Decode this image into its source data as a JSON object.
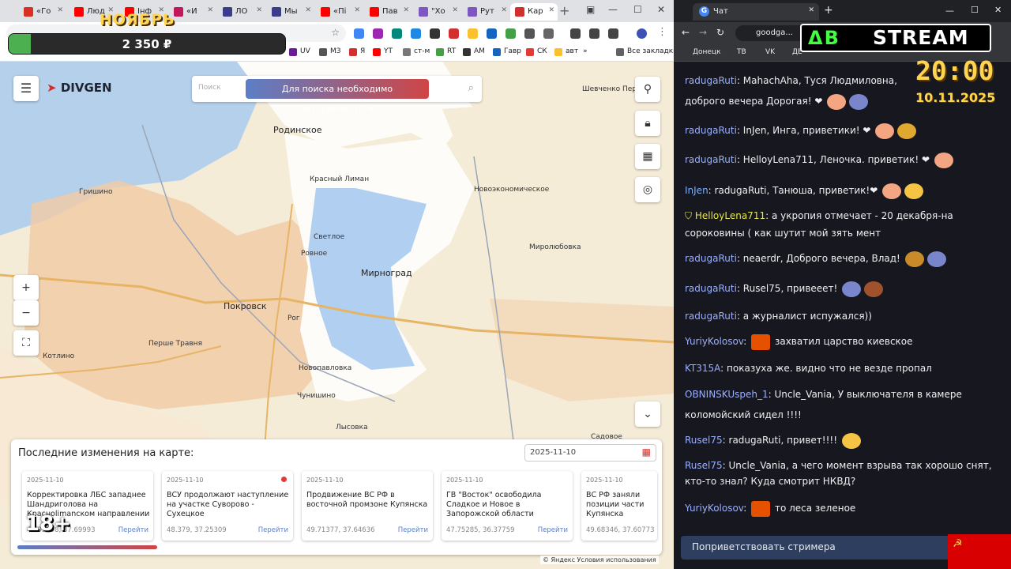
{
  "left_browser": {
    "tabs": [
      {
        "label": "«Го",
        "color": "#d93025"
      },
      {
        "label": "Люд",
        "color": "#ff0000"
      },
      {
        "label": "Інф",
        "color": "#ff0000"
      },
      {
        "label": "«И",
        "color": "#c2185b"
      },
      {
        "label": "ЛО",
        "color": "#3c3c8c"
      },
      {
        "label": "Мы",
        "color": "#3c3c8c"
      },
      {
        "label": "«Пі",
        "color": "#ff0000"
      },
      {
        "label": "Пав",
        "color": "#ff0000"
      },
      {
        "label": "\"Хо",
        "color": "#7e57c2"
      },
      {
        "label": "Рут",
        "color": "#7e57c2"
      },
      {
        "label": "Кар",
        "color": "#d32f2f",
        "active": true
      }
    ],
    "bookmarks": [
      "UV",
      "МЗ",
      "Я",
      "YT",
      "ст-м",
      "RT",
      "АМ",
      "Гавр",
      "СК",
      "авт",
      "»",
      "Все закладки"
    ]
  },
  "overlay": {
    "month": "НОЯБРЬ",
    "amount": "2 350 ₽",
    "progress": 0.08,
    "age": "18+"
  },
  "map_app": {
    "brand": "DIVGEN",
    "search_placeholder": "Поиск",
    "auth_prompt": "Для поиска необходимо авторизоваться",
    "zoom_in": "+",
    "zoom_out": "−",
    "labels": {
      "rodinskoe": "Родинское",
      "krasny_liman": "Красный Лиман",
      "grishino": "Гришино",
      "svetloe": "Светлое",
      "rovnoe": "Ровное",
      "mirnograd": "Мирноград",
      "pokrovsk": "Покровск",
      "rog": "Рог",
      "novopavlovka": "Новопавловка",
      "pershe_travnya": "Перше Травня",
      "kotlino": "Котлино",
      "chunishino": "Чунишино",
      "lysovka": "Лысовка",
      "novoekonomicheskoe": "Новоэкономическое",
      "mirolyubovka": "Миролюбовка",
      "shevchenko": "Шевченко Первое",
      "sadovoe": "Садовое"
    },
    "panel": {
      "title": "Последние изменения на карте:",
      "date": "2025-11-10",
      "open_label": "Перейти",
      "cards": [
        {
          "date": "2025-11-10",
          "title": "Корректировка ЛБС западнее Шандриголова на Красноlimanском направлении",
          "coords": "48.99998, 37.69993"
        },
        {
          "date": "2025-11-10",
          "title": "ВСУ продолжают наступление на участке Суворово - Сухецкое",
          "coords": "48.379, 37.25309",
          "dot": true
        },
        {
          "date": "2025-11-10",
          "title": "Продвижение ВС РФ в восточной промзоне Купянска",
          "coords": "49.71377, 37.64636"
        },
        {
          "date": "2025-11-10",
          "title": "ГВ \"Восток\" освободила Сладкое и Новое в Запорожской области",
          "coords": "47.75285, 36.37759"
        },
        {
          "date": "2025-11-10",
          "title": "ВС РФ заняли позиции части Купянска",
          "coords": "49.68346, 37.60773"
        }
      ]
    },
    "attribution": "© Яндекс Условия использования"
  },
  "right_browser": {
    "tab_label": "Чат",
    "url": "goodga...",
    "bookmarks": [
      "Донецк",
      "ТВ",
      "VK",
      "ДЕ"
    ]
  },
  "stream": {
    "logo_a": "ΔB",
    "logo_b": "STREAM",
    "time": "20:00",
    "date": "10.11.2025"
  },
  "chat": [
    {
      "user": "radugaRuti",
      "color": "#9ab0ff",
      "text": "MahachAha, Туся Людмиловна, доброго вечера Дорогая! ❤"
    },
    {
      "user": "radugaRuti",
      "color": "#9ab0ff",
      "text": "InJen, Инга, приветики! ❤"
    },
    {
      "user": "radugaRuti",
      "color": "#9ab0ff",
      "text": "HelloyLena711, Леночка. приветик! ❤"
    },
    {
      "user": "InJen",
      "color": "#7ab0ff",
      "text": "radugaRuti, Танюша, приветик!❤"
    },
    {
      "user": "HelloyLena711",
      "color": "#e6e64a",
      "text": "а укропия отмечает - 20 декабря-на сороковины ( как шутит мой зять мент"
    },
    {
      "user": "radugaRuti",
      "color": "#9ab0ff",
      "text": "neaerdr, Доброго вечера, Влад!"
    },
    {
      "user": "radugaRuti",
      "color": "#9ab0ff",
      "text": "Rusel75, привееет!"
    },
    {
      "user": "radugaRuti",
      "color": "#9ab0ff",
      "text": "а журналист испужался))"
    },
    {
      "user": "YuriyKolosov",
      "color": "#9ab0ff",
      "text": "захватил царство киевское"
    },
    {
      "user": "KT315A",
      "color": "#9ab0ff",
      "text": "показуха же. видно что не везде пропал"
    },
    {
      "user": "OBNINSKUspeh_1",
      "color": "#9ab0ff",
      "text": "Uncle_Vania, У выключателя в камере коломойский сидел !!!!"
    },
    {
      "user": "Rusel75",
      "color": "#9ab0ff",
      "text": "radugaRuti, привет!!!!"
    },
    {
      "user": "Rusel75",
      "color": "#9ab0ff",
      "text": "Uncle_Vania, а чего момент взрыва так хорошо снят, кто-то знал? Куда смотрит НКВД?"
    },
    {
      "user": "YuriyKolosov",
      "color": "#9ab0ff",
      "text": "то леса зеленое"
    }
  ],
  "greet_button": "Поприветствовать стримера"
}
